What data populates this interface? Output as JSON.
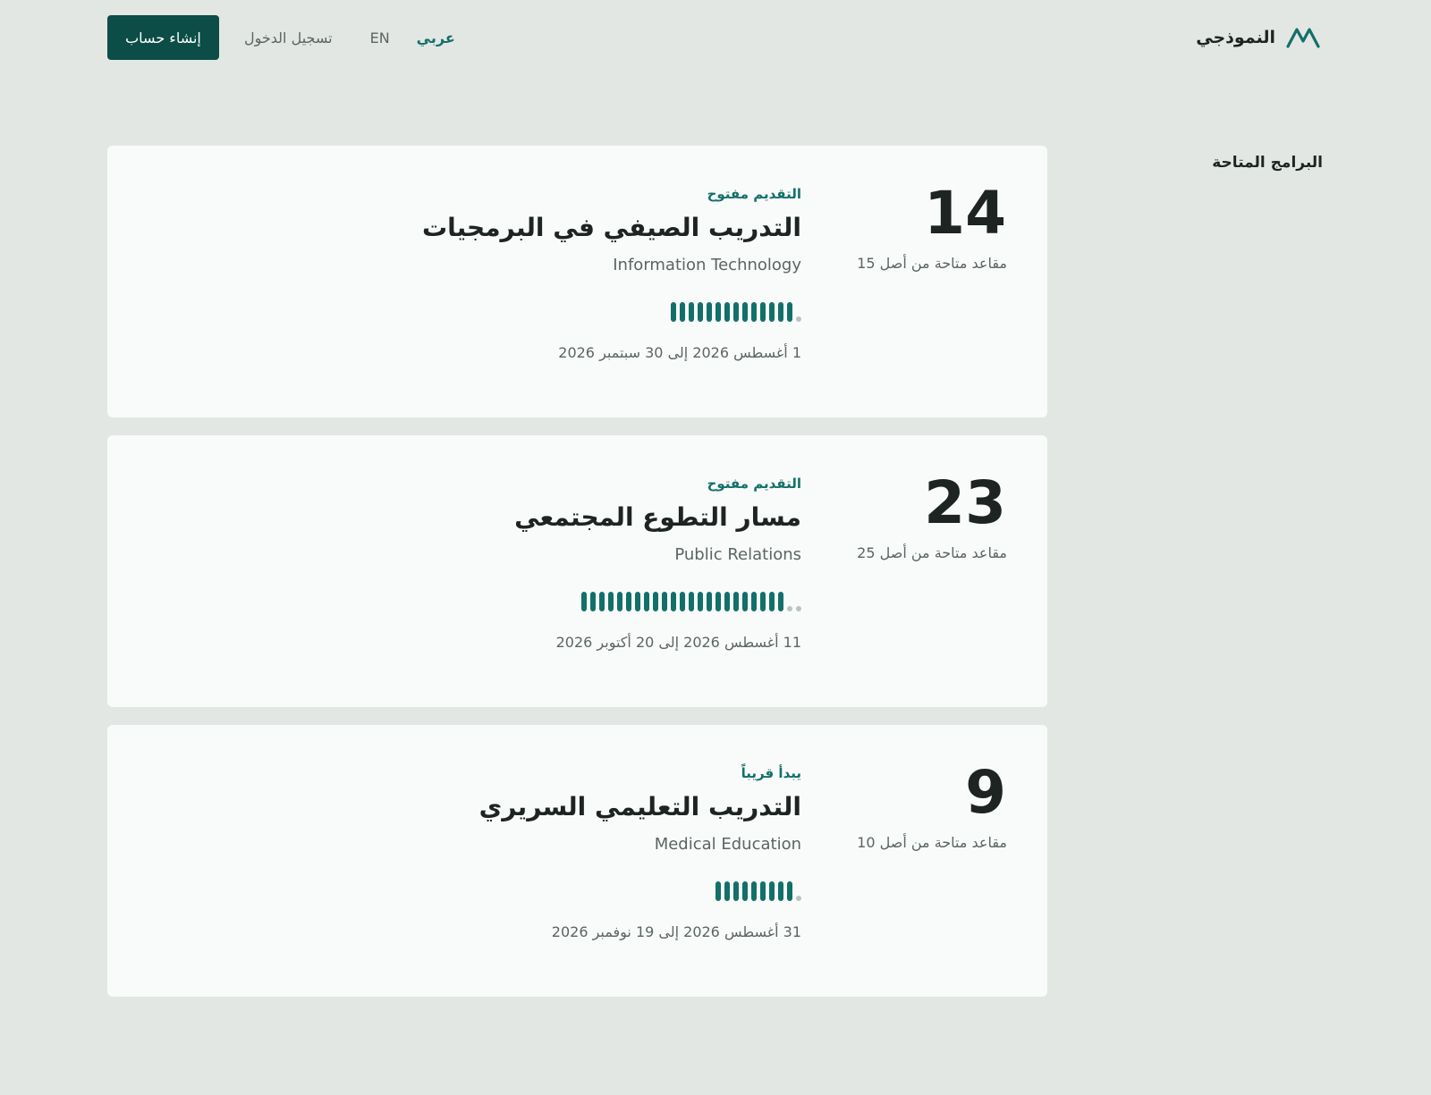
{
  "header": {
    "logo_text": "النموذجي",
    "logo_icon": "mountain-logo-icon",
    "lang_ar": "عربي",
    "lang_en": "EN",
    "login_label": "تسجيل الدخول",
    "signup_label": "إنشاء حساب"
  },
  "section_title": "البرامج المتاحة",
  "colors": {
    "accent": "#137069",
    "primary_button": "#0c4d47",
    "background": "#e3e7e4",
    "card": "#f9fbfa",
    "seat_empty": "#b9c4c1"
  },
  "programs": [
    {
      "seats_available": "14",
      "seats_caption": "مقاعد متاحة من أصل 15",
      "seats_total": 15,
      "status": "التقديم مفتوح",
      "title": "التدريب الصيفي في البرمجيات",
      "department": "Information Technology",
      "dates": "1 أغسطس 2026 إلى 30 سبتمبر 2026"
    },
    {
      "seats_available": "23",
      "seats_caption": "مقاعد متاحة من أصل 25",
      "seats_total": 25,
      "status": "التقديم مفتوح",
      "title": "مسار التطوع المجتمعي",
      "department": "Public Relations",
      "dates": "11 أغسطس 2026 إلى 20 أكتوبر 2026"
    },
    {
      "seats_available": "9",
      "seats_caption": "مقاعد متاحة من أصل 10",
      "seats_total": 10,
      "status": "يبدأ قريباً",
      "title": "التدريب التعليمي السريري",
      "department": "Medical Education",
      "dates": "31 أغسطس 2026 إلى 19 نوفمبر 2026"
    }
  ]
}
